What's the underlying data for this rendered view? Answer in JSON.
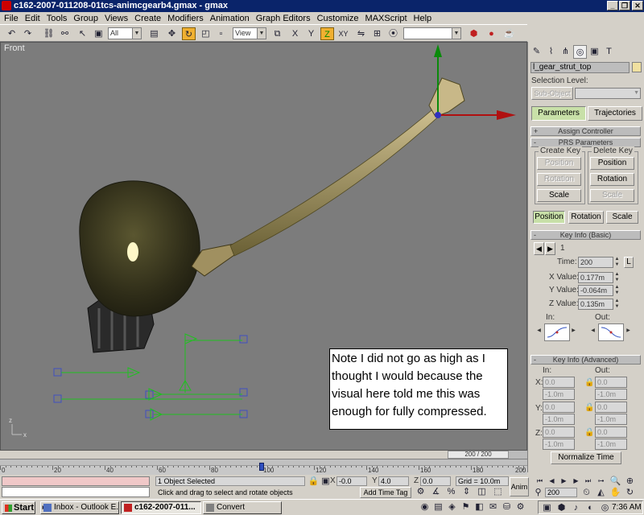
{
  "window": {
    "title": "c162-2007-011208-01tcs-animcgearb4.gmax - gmax",
    "minimize": "_",
    "restore": "❐",
    "close": "✕"
  },
  "menu": [
    "File",
    "Edit",
    "Tools",
    "Group",
    "Views",
    "Create",
    "Modifiers",
    "Animation",
    "Graph Editors",
    "Customize",
    "MAXScript",
    "Help"
  ],
  "toolbar": {
    "selection_filter": "All",
    "ref_coord": "View",
    "named_sel": ""
  },
  "viewport": {
    "label": "Front",
    "counter": "200 / 200",
    "note": "Note I did not go as high as I thought I would because the visual here told me this was enough for fully compressed."
  },
  "command_panel": {
    "object_name": "l_gear_strut_top",
    "selection_level_label": "Selection Level:",
    "sub_object": "Sub-Object",
    "tab_parameters": "Parameters",
    "tab_trajectories": "Trajectories",
    "rollup_assign": "Assign Controller",
    "rollup_prs": "PRS Parameters",
    "create_key": "Create Key",
    "delete_key": "Delete Key",
    "create_position": "Position",
    "create_rotation": "Rotation",
    "create_scale": "Scale",
    "delete_position": "Position",
    "delete_rotation": "Rotation",
    "delete_scale": "Scale",
    "mode_position": "Position",
    "mode_rotation": "Rotation",
    "mode_scale": "Scale",
    "rollup_keyinfo_basic": "Key Info (Basic)",
    "key_number": "1",
    "time_label": "Time:",
    "time_value": "200",
    "time_lock": "L",
    "x_label": "X Value:",
    "x_value": "0.177m",
    "y_label": "Y Value:",
    "y_value": "-0.064m",
    "z_label": "Z Value:",
    "z_value": "0.135m",
    "in_label": "In:",
    "out_label": "Out:",
    "rollup_keyinfo_adv": "Key Info (Advanced)",
    "adv_in": "In:",
    "adv_out": "Out:",
    "adv_x": "X:",
    "adv_y": "Y:",
    "adv_z": "Z:",
    "adv_values": {
      "x_in": "0.0",
      "x_in2": "-1.0m",
      "x_out": "0.0",
      "x_out2": "-1.0m",
      "y_in": "0.0",
      "y_in2": "-1.0m",
      "y_out": "0.0",
      "y_out2": "-1.0m",
      "z_in": "0.0",
      "z_in2": "-1.0m",
      "z_out": "0.0",
      "z_out2": "-1.0m"
    },
    "normalize_time": "Normalize Time"
  },
  "timeline": {
    "ticks": [
      "0",
      "20",
      "40",
      "60",
      "80",
      "100",
      "120",
      "140",
      "160",
      "180",
      "200"
    ]
  },
  "status": {
    "selected": "1 Object Selected",
    "prompt": "Click and drag to select and rotate objects",
    "x_label": "X",
    "x_value": "-0.0",
    "y_label": "Y",
    "y_value": "4.0",
    "z_label": "Z",
    "z_value": "0.0",
    "grid": "Grid = 10.0m",
    "add_time_tag": "Add Time Tag",
    "anim": "Anim",
    "current_frame": "200"
  },
  "taskbar": {
    "start": "Start",
    "tasks": [
      "Inbox - Outlook E...",
      "c162-2007-011...",
      "Convert"
    ],
    "clock": "7:36 AM"
  }
}
